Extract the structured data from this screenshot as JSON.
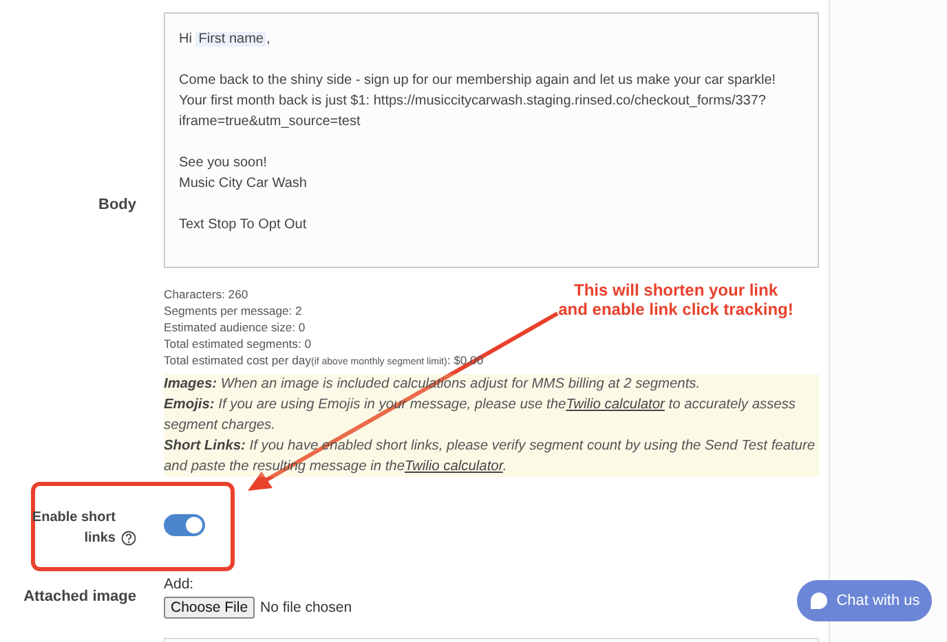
{
  "body": {
    "label": "Body",
    "greeting": "Hi",
    "merge_tag": "First name",
    "greeting_end": ",",
    "paragraphs": [
      [
        "Come back to the shiny side - sign up for our membership again and let us make your car sparkle!",
        "Your first month back is just $1: https://musiccitycarwash.staging.rinsed.co/checkout_forms/337?",
        "iframe=true&utm_source=test"
      ],
      [
        "See you soon!",
        "Music City Car Wash"
      ],
      [
        "Text Stop To Opt Out"
      ]
    ]
  },
  "stats": [
    {
      "text": "Characters: 260"
    },
    {
      "text": "Segments per message: 2"
    },
    {
      "text": "Estimated audience size: 0"
    },
    {
      "text": "Total estimated segments: 0"
    },
    {
      "text": "Total estimated cost per day",
      "note": "(if above monthly segment limit)",
      "suffix": ": $0.00"
    }
  ],
  "notes": [
    {
      "label": "Images:",
      "parts": [
        {
          "kind": "text",
          "text": "When an image is included calculations adjust for MMS billing at 2 segments."
        }
      ]
    },
    {
      "label": "Emojis:",
      "parts": [
        {
          "kind": "text",
          "text": "If you are using Emojis in your message, please use the"
        },
        {
          "kind": "link",
          "text": "Twilio calculator"
        },
        {
          "kind": "text",
          "text": "to accurately assess segment charges."
        }
      ]
    },
    {
      "label": "Short Links:",
      "parts": [
        {
          "kind": "text",
          "text": "If you have enabled short links, please verify segment count by using the Send Test feature and paste the resulting message in the"
        },
        {
          "kind": "link",
          "text": "Twilio calculator"
        },
        {
          "kind": "text",
          "text": "."
        }
      ]
    }
  ],
  "short_links": {
    "label": "Enable short links",
    "on": true
  },
  "attached_image": {
    "label": "Attached image",
    "add": "Add:",
    "button": "Choose File",
    "status": "No file chosen"
  },
  "annotation": {
    "lines": [
      "This will shorten your link",
      "and enable link click tracking!"
    ]
  },
  "chat_button": {
    "label": "Chat with us"
  }
}
